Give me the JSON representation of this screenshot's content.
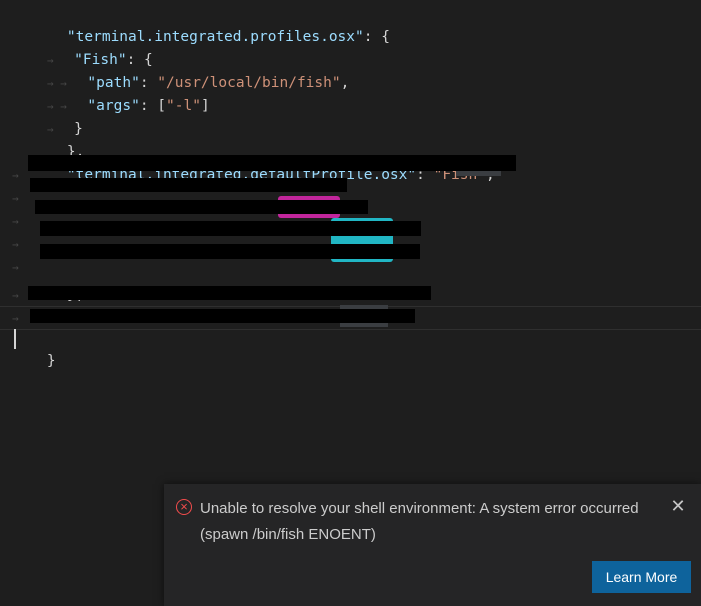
{
  "editor": {
    "lines": [
      {
        "ws": "",
        "key": "\"terminal.integrated.profiles.osx\"",
        "punc": ": {"
      },
      {
        "ws": "→ ",
        "key": "\"Fish\"",
        "punc": ": {"
      },
      {
        "ws": "→ → ",
        "key": "\"path\"",
        "sep": ": ",
        "str": "\"/usr/local/bin/fish\"",
        "tail": ","
      },
      {
        "ws": "→ → ",
        "key": "\"args\"",
        "sep": ": [",
        "str": "\"-l\"",
        "tail": "]"
      },
      {
        "ws": "→ ",
        "punc": "}"
      },
      {
        "ws": "",
        "punc": "},"
      },
      {
        "ws": "",
        "key": "\"terminal.integrated.defaultProfile.osx\"",
        "sep": ": ",
        "str": "\"Fish\"",
        "tail": ","
      },
      {
        "ws": "→ "
      },
      {
        "ws": "→ "
      },
      {
        "ws": "→ "
      },
      {
        "ws": "→ "
      },
      {
        "ws": "→ "
      },
      {
        "ws": "",
        "punc": "},"
      },
      {
        "ws": "→ "
      },
      {
        "ws": "→ "
      },
      {
        "ws": "",
        "punc": "}"
      }
    ]
  },
  "notification": {
    "icon": "error-circle-icon",
    "message": "Unable to resolve your shell environment: A system error occurred (spawn /bin/fish ENOENT)",
    "close_icon": "close-icon",
    "button_label": "Learn More",
    "colors": {
      "error": "#f14c4c",
      "button": "#0e639c",
      "background": "#252526"
    }
  }
}
